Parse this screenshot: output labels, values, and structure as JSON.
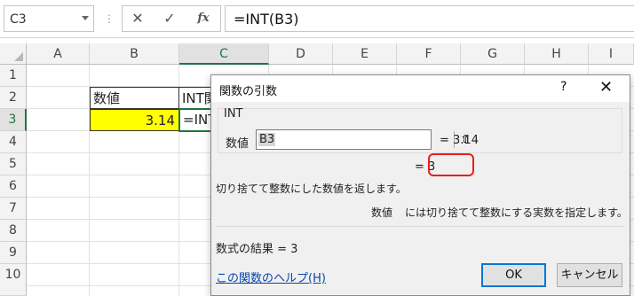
{
  "formula_bar": {
    "name_box": "C3",
    "separator": "⋮",
    "cancel_glyph": "✕",
    "enter_glyph": "✓",
    "fx_label": "fx",
    "formula": "=INT(B3)"
  },
  "columns": [
    "A",
    "B",
    "C",
    "D",
    "E",
    "F",
    "G",
    "H",
    "I"
  ],
  "rows": [
    "1",
    "2",
    "3",
    "4",
    "5",
    "6",
    "7",
    "8",
    "9",
    "10"
  ],
  "cells": {
    "B2": "数値",
    "B3": "3.14",
    "C2": "INT関",
    "C3": "=INT"
  },
  "colors": {
    "highlight_fill": "#ffff00",
    "selection": "#217346",
    "annotation": "#e8201c",
    "link": "#0645ad"
  },
  "dialog": {
    "title": "関数の引数",
    "help_button": "?",
    "close_button": "✕",
    "function_name": "INT",
    "arg_label": "数値",
    "arg_value": "B3",
    "arg_collapse_icon": "⇧",
    "arg_result": "=  3.14",
    "formula_result_preview": "=  3",
    "description": "切り捨てて整数にした数値を返します。",
    "arg_desc_name": "数値",
    "arg_desc_text": "には切り捨てて整数にする実数を指定します。",
    "result_label": "数式の結果 =   3",
    "help_link": "この関数のヘルプ(H)",
    "ok_label": "OK",
    "cancel_label": "キャンセル"
  }
}
